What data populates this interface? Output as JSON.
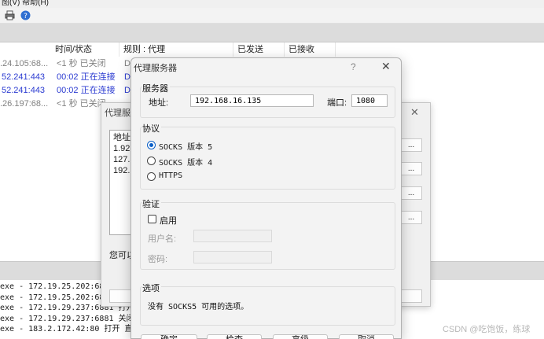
{
  "menubar": {
    "text": "图(V)  帮助(H)"
  },
  "toolbar": {
    "icons": [
      "printer-icon",
      "help-icon"
    ]
  },
  "grid": {
    "headers": [
      "时间/状态",
      "规则 : 代理",
      "已发送",
      "已接收"
    ],
    "rows": [
      {
        "host": ".24.105:68...",
        "status": "<1 秒 已关闭",
        "rule": "D",
        "tone": "gray"
      },
      {
        "host": "52.241:443",
        "status": "00:02 正在连接",
        "rule": "D",
        "tone": "blue"
      },
      {
        "host": "52.241:443",
        "status": "00:02 正在连接",
        "rule": "D",
        "tone": "blue"
      },
      {
        "host": ".26.197:68...",
        "status": "<1 秒 已关闭",
        "rule": "",
        "tone": "gray"
      }
    ]
  },
  "log": [
    "exe - 172.19.25.202:68",
    "exe - 172.19.25.202:68",
    "exe - 172.19.29.237:6881 打开",
    "exe - 172.19.29.237:6881 关闭",
    "exe - 183.2.172.42:80 打开 直"
  ],
  "back_dialog": {
    "title": "代理服务器",
    "list_header": "地址",
    "list_items": [
      "1.92",
      "127.",
      "192."
    ],
    "note": "您可以",
    "side_buttons": [
      "...",
      "...",
      "...",
      "..."
    ]
  },
  "dialog": {
    "title": "代理服务器",
    "help": "?",
    "close": "✕",
    "server": {
      "group_label": "服务器",
      "address_label": "地址:",
      "address_value": "192.168.16.135",
      "port_label": "端口:",
      "port_value": "1080"
    },
    "protocol": {
      "group_label": "协议",
      "options": [
        "SOCKS 版本 5",
        "SOCKS 版本 4",
        "HTTPS"
      ],
      "selected": "SOCKS 版本 5"
    },
    "auth": {
      "group_label": "验证",
      "enable_label": "启用",
      "enabled": false,
      "username_label": "用户名:",
      "username_value": "",
      "password_label": "密码:",
      "password_value": ""
    },
    "options": {
      "group_label": "选项",
      "text": "没有 SOCKS5 可用的选项。"
    },
    "buttons": [
      "确定",
      "检查",
      "高级",
      "取消"
    ]
  },
  "watermark": "CSDN @吃饱饭，练球",
  "colors": {
    "accent": "#0a5fc7",
    "link_blue": "#2b3bd1",
    "gray_text": "#808080"
  }
}
